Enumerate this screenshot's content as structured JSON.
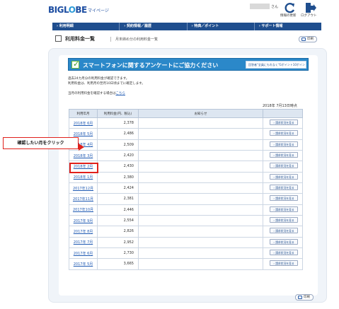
{
  "header": {
    "logo_main": "BIGL",
    "logo_o": "O",
    "logo_end": "BE",
    "logo_sub": "マイページ",
    "user_suffix": "さん",
    "icon1_label": "情報の更新",
    "icon2_label": "ログアウト",
    "icon1_name": "refresh-icon",
    "icon2_name": "logout-icon"
  },
  "nav": [
    {
      "label": "› 利用明細"
    },
    {
      "label": "› 契約情報／履歴"
    },
    {
      "label": "› 特典／ポイント"
    },
    {
      "label": "› サポート情報"
    }
  ],
  "titlebar": {
    "title": "利用料金一覧",
    "subtitle": "月末締め分の利用料金一覧",
    "print_label": "印刷"
  },
  "banner": {
    "text": "スマートフォンに関するアンケートにご協力ください",
    "badge": "回答者\"全員にもれなく\"Gポイント10ポイント"
  },
  "notes": {
    "line1": "過去24カ月分の利用料金が確認できます。",
    "line2": "利用料金は、利用月の翌月10日頃までに確定します。",
    "line3_prefix": "当月の利用料金を確認する場合は",
    "line3_link": "こちら",
    "asof": "2018年 7月13日時点"
  },
  "table": {
    "headers": [
      "利用年月",
      "利用料金(円、税込)",
      "お知らせ",
      ""
    ],
    "detail_label": "› 請求状況を見る",
    "rows": [
      {
        "month": "2018年 6月",
        "amount": "2,378"
      },
      {
        "month": "2018年 5月",
        "amount": "2,486"
      },
      {
        "month": "2018年 4月",
        "amount": "2,509"
      },
      {
        "month": "2018年 3月",
        "amount": "2,420"
      },
      {
        "month": "2018年 2月",
        "amount": "2,430"
      },
      {
        "month": "2018年 1月",
        "amount": "2,380"
      },
      {
        "month": "2017年12月",
        "amount": "2,424"
      },
      {
        "month": "2017年11月",
        "amount": "2,381"
      },
      {
        "month": "2017年10月",
        "amount": "2,446"
      },
      {
        "month": "2017年 9月",
        "amount": "2,554"
      },
      {
        "month": "2017年 8月",
        "amount": "2,826"
      },
      {
        "month": "2017年 7月",
        "amount": "2,952"
      },
      {
        "month": "2017年 6月",
        "amount": "2,730"
      },
      {
        "month": "2017年 5月",
        "amount": "3,665"
      }
    ]
  },
  "callout": {
    "text": "確認したい月をクリック",
    "color": "#e0201b"
  },
  "bottom": {
    "print_label": "印刷"
  }
}
